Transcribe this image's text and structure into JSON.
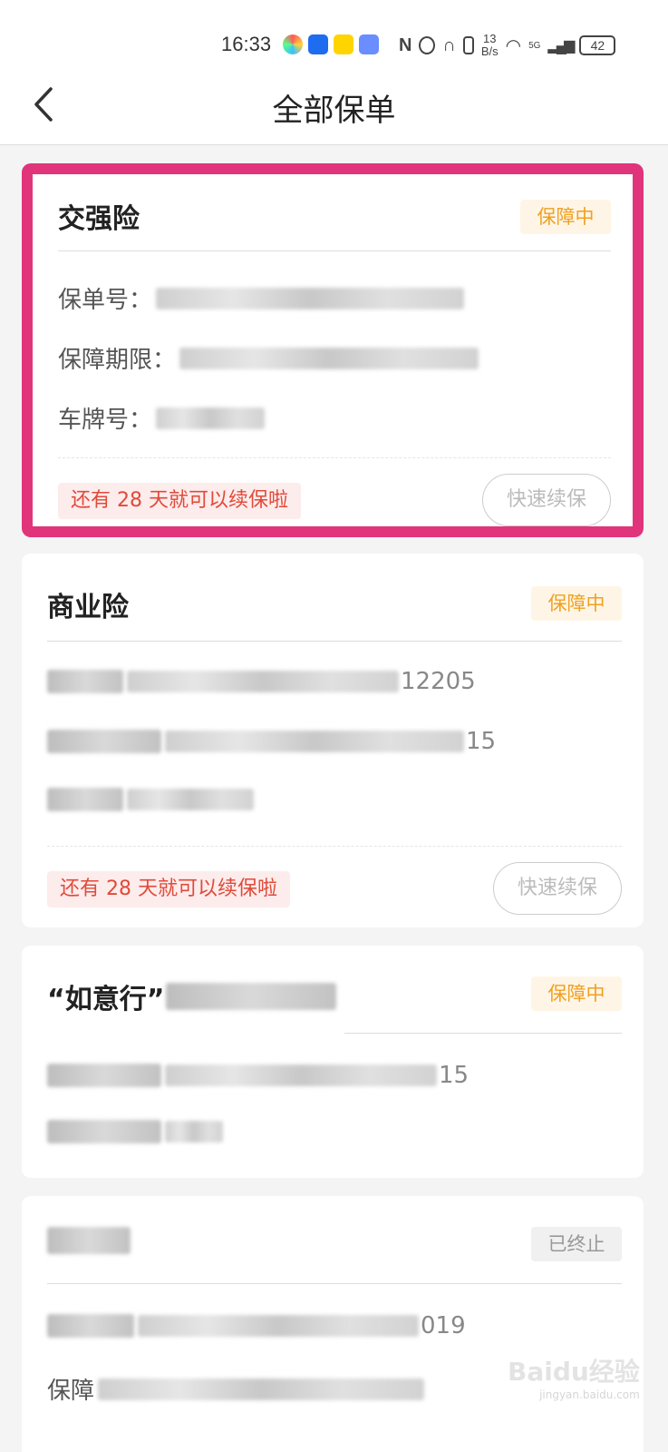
{
  "status": {
    "time": "16:33",
    "net_speed_value": "13",
    "net_speed_unit": "B/s",
    "network": "5G",
    "battery": "42"
  },
  "nav": {
    "title": "全部保单"
  },
  "cards": [
    {
      "title": "交强险",
      "badge": "保障中",
      "policy_label": "保单号：",
      "period_label": "保障期限：",
      "plate_label": "车牌号：",
      "reminder": "还有 28 天就可以续保啦",
      "renew": "快速续保"
    },
    {
      "title": "商业险",
      "badge": "保障中",
      "policy_tail": "12205",
      "period_tail": "15",
      "reminder": "还有 28 天就可以续保啦",
      "renew": "快速续保"
    },
    {
      "title": "“如意行”",
      "badge": "保障中",
      "period_tail": "15"
    },
    {
      "badge": "已终止",
      "policy_tail": "019",
      "period_label": "保障"
    }
  ],
  "watermark": {
    "brand": "Baidu经验",
    "url": "jingyan.baidu.com"
  },
  "colors": {
    "highlight": "#e0357a",
    "active_badge": "#f0a020",
    "reminder": "#e04a3a"
  }
}
